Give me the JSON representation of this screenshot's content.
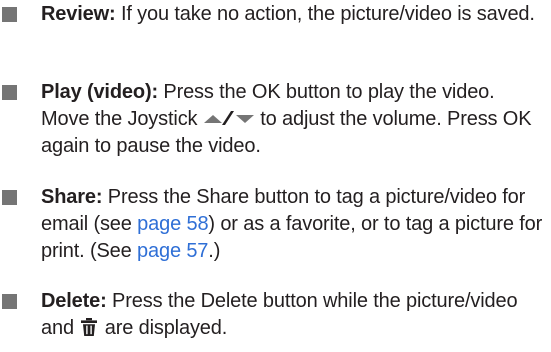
{
  "items": [
    {
      "label": "Review:",
      "text": " If you take no action, the picture/video is saved."
    },
    {
      "label": "Play (video):",
      "text_a": " Press the OK button to play the video. Move the Joystick ",
      "icon": "joystick-up-down-icon",
      "text_b": " to adjust the volume. Press OK again to pause the video."
    },
    {
      "label": "Share:",
      "text_a": " Press the Share button to tag a picture/video for email (see ",
      "link_1": "page 58",
      "text_b": ") or as a favorite, or to tag a picture for print. (See ",
      "link_2": "page 57",
      "text_c": ".)"
    },
    {
      "label": "Delete:",
      "text_a": " Press the Delete button while the picture/video and ",
      "icon": "trash-icon",
      "text_b": " are displayed."
    }
  ],
  "colors": {
    "text": "#231f20",
    "bullet": "#757575",
    "link": "#2f6fd6"
  }
}
